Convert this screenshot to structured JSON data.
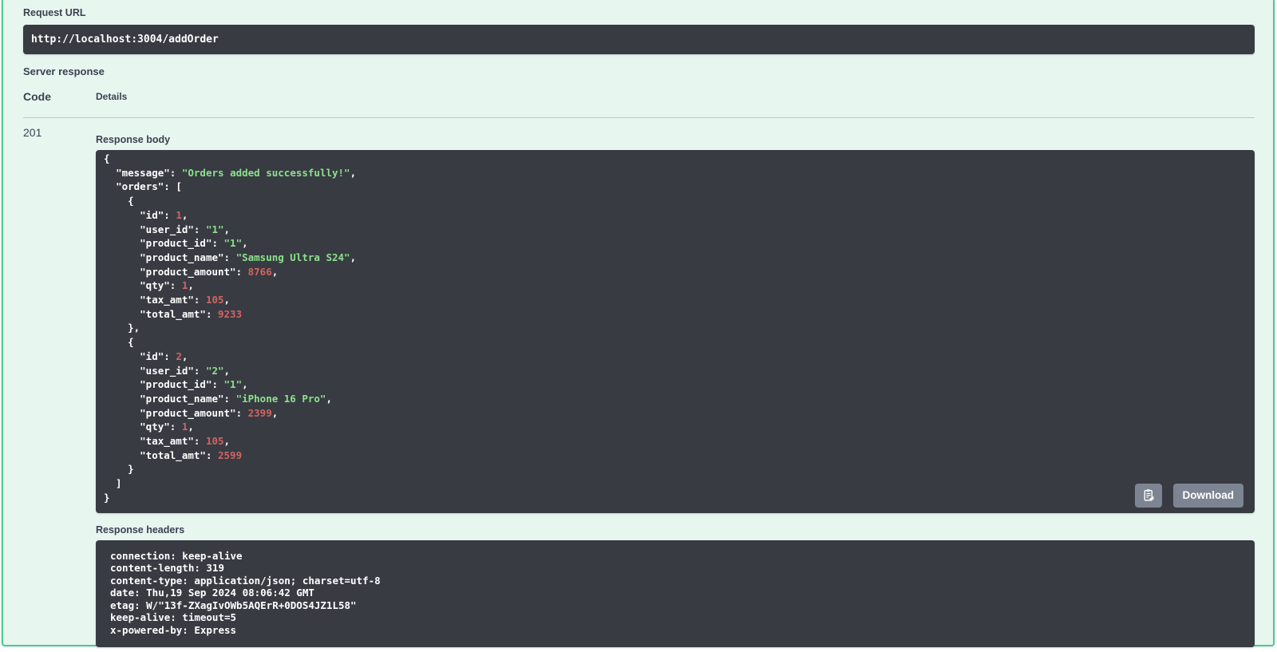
{
  "colors": {
    "accent_green": "#49cc90",
    "panel_bg": "#e8f6f0",
    "code_bg": "#383b42",
    "heading_text": "#3b4151",
    "json_string": "#8ce28c",
    "json_number": "#d36363",
    "button_bg": "#7d8492"
  },
  "request": {
    "label": "Request URL",
    "url": "http://localhost:3004/addOrder"
  },
  "server_response": {
    "title": "Server response",
    "columns": {
      "code": "Code",
      "details": "Details"
    },
    "status_code": "201",
    "body": {
      "label": "Response body",
      "json": {
        "message": "Orders added successfully!",
        "orders": [
          {
            "id": 1,
            "user_id": "1",
            "product_id": "1",
            "product_name": "Samsung Ultra S24",
            "product_amount": 8766,
            "qty": 1,
            "tax_amt": 105,
            "total_amt": 9233
          },
          {
            "id": 2,
            "user_id": "2",
            "product_id": "1",
            "product_name": "iPhone 16 Pro",
            "product_amount": 2399,
            "qty": 1,
            "tax_amt": 105,
            "total_amt": 2599
          }
        ]
      },
      "copy_icon": "clipboard-copy-icon",
      "download_label": "Download"
    },
    "headers": {
      "label": "Response headers",
      "lines": [
        "connection: keep-alive",
        "content-length: 319",
        "content-type: application/json; charset=utf-8",
        "date: Thu,19 Sep 2024 08:06:42 GMT",
        "etag: W/\"13f-ZXagIvOWb5AQErR+0DOS4JZ1L58\"",
        "keep-alive: timeout=5",
        "x-powered-by: Express"
      ]
    }
  }
}
